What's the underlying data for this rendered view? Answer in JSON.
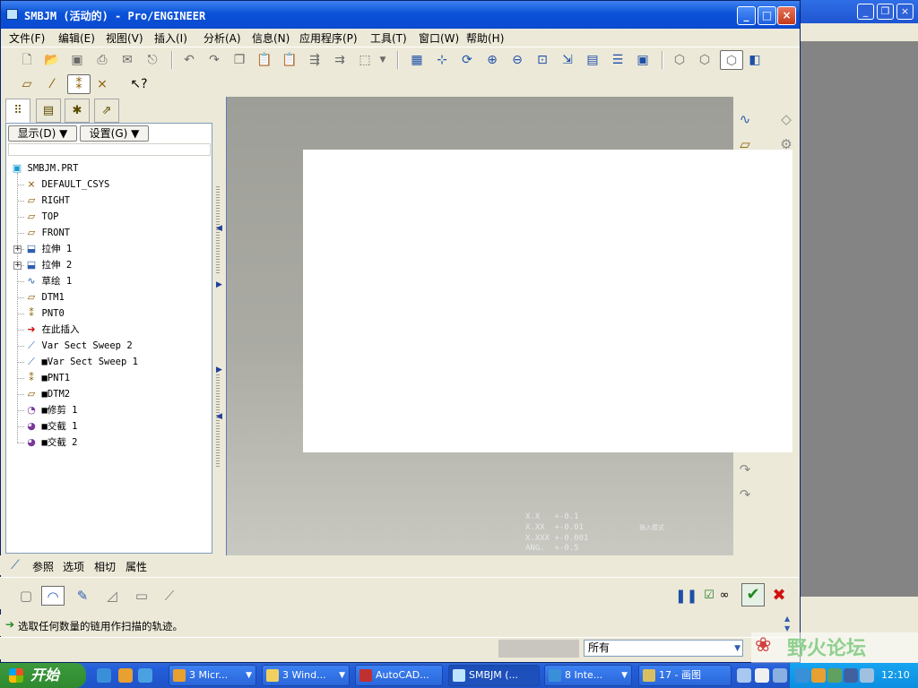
{
  "window": {
    "title": "SMBJM (活动的) - Pro/ENGINEER",
    "minimize": "_",
    "maximize": "□",
    "close": "×"
  },
  "menubar": [
    "文件(F)",
    "编辑(E)",
    "视图(V)",
    "插入(I)",
    "分析(A)",
    "信息(N)",
    "应用程序(P)",
    "工具(T)",
    "窗口(W)",
    "帮助(H)"
  ],
  "left_panel": {
    "show_button": "显示(D) ▼",
    "settings_button": "设置(G) ▼",
    "tabs": [
      "model-tree-tab",
      "layers-tab",
      "favorites-tab",
      "connections-tab"
    ]
  },
  "model_tree": [
    {
      "label": "SMBJM.PRT",
      "icon": "part-icon"
    },
    {
      "label": "DEFAULT_CSYS",
      "icon": "csys-icon"
    },
    {
      "label": "RIGHT",
      "icon": "datum-plane-icon"
    },
    {
      "label": "TOP",
      "icon": "datum-plane-icon"
    },
    {
      "label": "FRONT",
      "icon": "datum-plane-icon"
    },
    {
      "label": "拉伸 1",
      "icon": "extrude-icon",
      "expandable": true
    },
    {
      "label": "拉伸 2",
      "icon": "extrude-icon",
      "expandable": true
    },
    {
      "label": "草绘 1",
      "icon": "sketch-icon"
    },
    {
      "label": "DTM1",
      "icon": "datum-plane-icon"
    },
    {
      "label": "PNT0",
      "icon": "datum-point-icon"
    },
    {
      "label": "在此插入",
      "icon": "insert-here-arrow-icon"
    },
    {
      "label": "Var Sect Sweep 2",
      "icon": "sweep-icon"
    },
    {
      "label": "■Var Sect Sweep 1",
      "icon": "sweep-icon"
    },
    {
      "label": "■PNT1",
      "icon": "datum-point-icon"
    },
    {
      "label": "■DTM2",
      "icon": "datum-plane-icon"
    },
    {
      "label": "■修剪 1",
      "icon": "trim-icon"
    },
    {
      "label": "■交截 1",
      "icon": "intersect-icon"
    },
    {
      "label": "■交截 2",
      "icon": "intersect-icon"
    }
  ],
  "graphics": {
    "tolerances": [
      "X.X   +-0.1",
      "X.XX  +-0.01",
      "X.XXX +-0.001",
      "ANG.  +-0.5"
    ],
    "insert_mode_note": "插入模式"
  },
  "dashboard": {
    "tabs": [
      "参照",
      "选项",
      "相切",
      "属性"
    ]
  },
  "status": {
    "message": "选取任何数量的链用作扫描的轨迹。",
    "filter_value": "所有"
  },
  "taskbar": {
    "start": "开始",
    "tasks": [
      "3 Micr...",
      "3 Wind...",
      "AutoCAD...",
      "SMBJM (...",
      "8 Inte...",
      "17 - 画图"
    ],
    "clock": "12:10",
    "watermark": "野火论坛"
  },
  "colors": {
    "accent": "#0a52d8",
    "confirm": "#1f8a1f",
    "cancel": "#d01010"
  }
}
